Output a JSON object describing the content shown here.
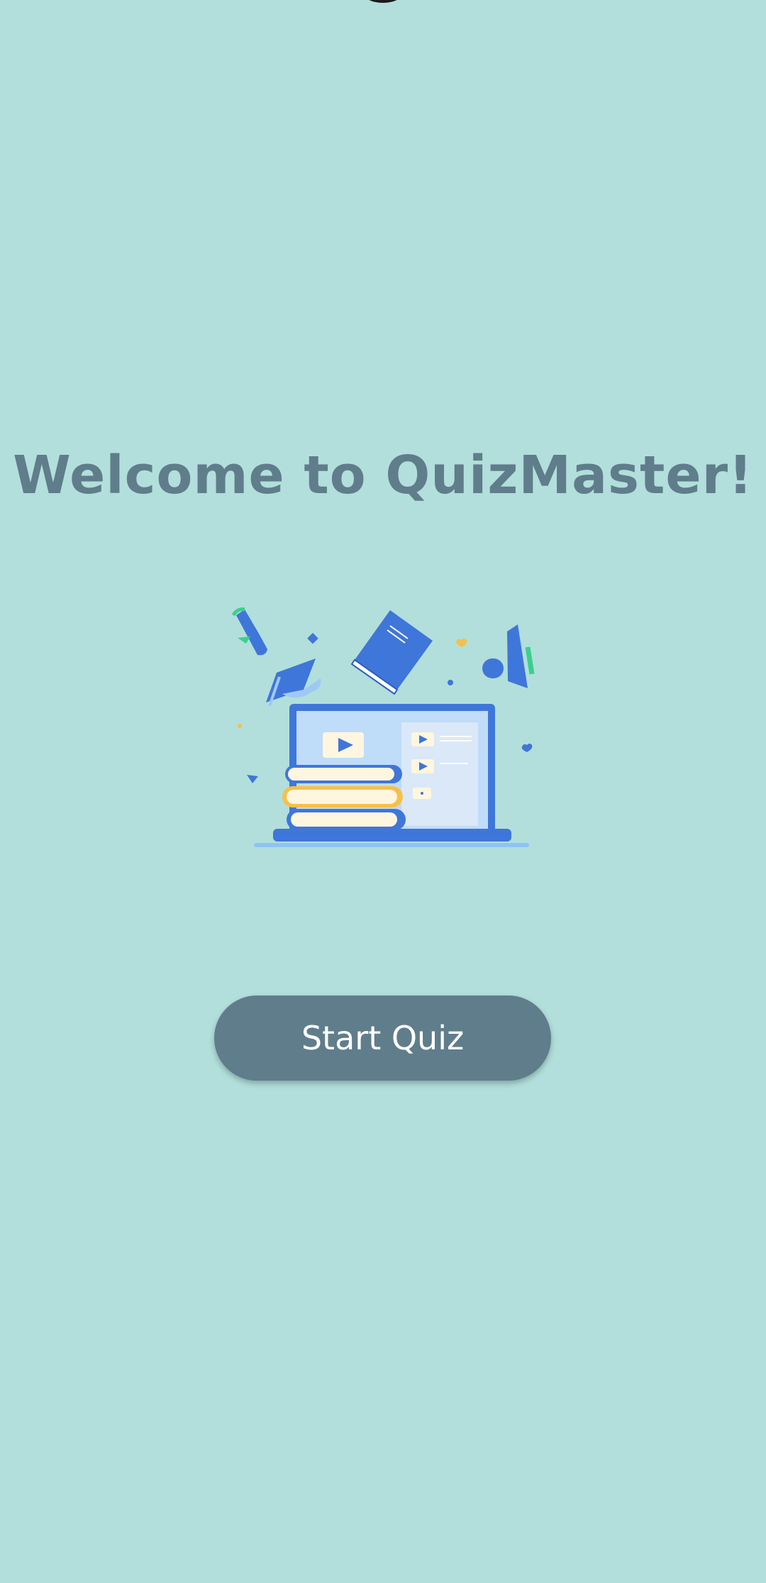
{
  "app": {
    "title": "Welcome to QuizMaster!",
    "start_label": "Start Quiz"
  },
  "colors": {
    "background": "#b2dfdb",
    "title": "#607d8b",
    "button": "#607d8b",
    "button_text": "#ffffff",
    "illustration_primary": "#3f76d9",
    "illustration_light": "#bfdcf9",
    "illustration_accent": "#f5c04a",
    "illustration_green": "#3ccf8e"
  },
  "illustration": {
    "icon": "laptop-books-education-illustration"
  }
}
